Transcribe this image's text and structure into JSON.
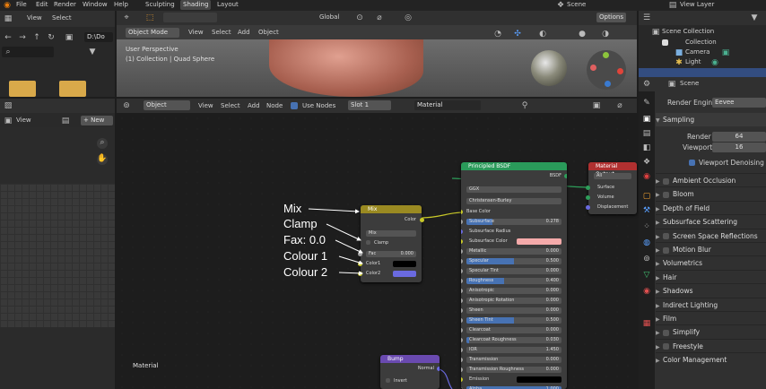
{
  "topbar": {
    "menus": [
      "File",
      "Edit",
      "Render",
      "Window",
      "Help"
    ],
    "tabs": [
      "Sculpting",
      "Shading",
      "Layout"
    ],
    "scene": "Scene",
    "view_layer": "View Layer"
  },
  "file_browser": {
    "view": "View",
    "select": "Select",
    "path": "D:\\Do"
  },
  "viewport": {
    "mode": "Object Mode",
    "menus": [
      "View",
      "Select",
      "Add",
      "Object"
    ],
    "transform": "Global",
    "options": "Options",
    "info1": "User Perspective",
    "info2": "(1) Collection | Quad Sphere"
  },
  "image_editor": {
    "view": "View",
    "new": "New"
  },
  "node_editor": {
    "object": "Object",
    "menus": [
      "View",
      "Select",
      "Add",
      "Node"
    ],
    "use_nodes": "Use Nodes",
    "slot": "Slot 1",
    "material": "Material",
    "footer": "Material"
  },
  "outliner": {
    "title": "Scene Collection",
    "items": [
      "Collection",
      "Camera",
      "Light"
    ]
  },
  "properties": {
    "scene": "Scene",
    "render_engine_label": "Render Engine",
    "render_engine": "Eevee",
    "sampling": "Sampling",
    "render_label": "Render",
    "render_value": "64",
    "viewport_label": "Viewport",
    "viewport_value": "16",
    "viewport_denoising": "Viewport Denoising",
    "panels": [
      "Ambient Occlusion",
      "Bloom",
      "Depth of Field",
      "Subsurface Scattering",
      "Screen Space Reflections",
      "Motion Blur",
      "Volumetrics",
      "Hair",
      "Shadows",
      "Indirect Lighting",
      "Film",
      "Simplify",
      "Freestyle",
      "Color Management"
    ],
    "panel_checkbox": [
      true,
      true,
      false,
      false,
      true,
      true,
      false,
      false,
      false,
      false,
      false,
      true,
      true,
      false
    ]
  },
  "mix_node": {
    "title": "Mix",
    "out": "Color",
    "blend": "Mix",
    "clamp": "Clamp",
    "fac_label": "Fac",
    "fac_value": "0.000",
    "color1": "Color1",
    "color2": "Color2",
    "color1_hex": "#000000",
    "color2_hex": "#6a6ae0"
  },
  "bsdf_node": {
    "title": "Principled BSDF",
    "out": "BSDF",
    "dist": "GGX",
    "sss_method": "Christensen-Burley",
    "base_color": "Base Color",
    "rows": [
      {
        "label": "Subsurface",
        "value": "0.278",
        "fill": 0.278
      },
      {
        "label": "Subsurface Radius",
        "value": "",
        "fill": -1
      },
      {
        "label": "Subsurface Color",
        "value": "",
        "fill": -2
      },
      {
        "label": "Metallic",
        "value": "0.000",
        "fill": 0
      },
      {
        "label": "Specular",
        "value": "0.500",
        "fill": 0.5
      },
      {
        "label": "Specular Tint",
        "value": "0.000",
        "fill": 0
      },
      {
        "label": "Roughness",
        "value": "0.400",
        "fill": 0.4
      },
      {
        "label": "Anisotropic",
        "value": "0.000",
        "fill": 0
      },
      {
        "label": "Anisotropic Rotation",
        "value": "0.000",
        "fill": 0
      },
      {
        "label": "Sheen",
        "value": "0.000",
        "fill": 0
      },
      {
        "label": "Sheen Tint",
        "value": "0.500",
        "fill": 0.5
      },
      {
        "label": "Clearcoat",
        "value": "0.000",
        "fill": 0
      },
      {
        "label": "Clearcoat Roughness",
        "value": "0.030",
        "fill": 0.03
      },
      {
        "label": "IOR",
        "value": "1.450",
        "fill": 0
      },
      {
        "label": "Transmission",
        "value": "0.000",
        "fill": 0
      },
      {
        "label": "Transmission Roughness",
        "value": "0.000",
        "fill": 0
      },
      {
        "label": "Emission",
        "value": "",
        "fill": -3
      },
      {
        "label": "Alpha",
        "value": "1.000",
        "fill": 1
      }
    ]
  },
  "output_node": {
    "title": "Material Output",
    "target": "All",
    "surface": "Surface",
    "volume": "Volume",
    "displacement": "Displacement"
  },
  "bump_node": {
    "title": "Bump",
    "out": "Normal",
    "invert": "Invert"
  },
  "annotations": [
    "Mix",
    "Clamp",
    "Fax: 0.0",
    "Colour 1",
    "Colour 2"
  ],
  "colors": {
    "mix_header": "#9a8a22",
    "bsdf_header": "#2a9a5a",
    "output_header": "#b03030",
    "bump_header": "#6a4ab0",
    "subsurface_color": "#f4aaaa"
  }
}
